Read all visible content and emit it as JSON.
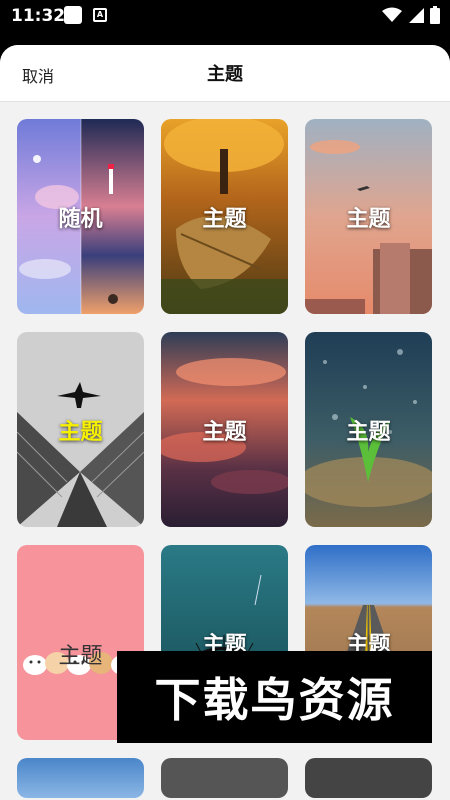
{
  "status_bar": {
    "time": "11:32",
    "notification_glyph": "A"
  },
  "header": {
    "cancel_label": "取消",
    "title": "主题"
  },
  "themes": [
    {
      "label": "随机",
      "label_color": "#ffffff"
    },
    {
      "label": "主题",
      "label_color": "#ffffff"
    },
    {
      "label": "主题",
      "label_color": "#ffffff"
    },
    {
      "label": "主题",
      "label_color": "#f7f000"
    },
    {
      "label": "主题",
      "label_color": "#ffffff"
    },
    {
      "label": "主题",
      "label_color": "#ffffff"
    },
    {
      "label": "主题",
      "label_color": "#333333"
    },
    {
      "label": "主题",
      "label_color": "#ffffff"
    },
    {
      "label": "主题",
      "label_color": "#ffffff"
    }
  ],
  "watermark": {
    "text": "下载鸟资源"
  },
  "icons": [
    "wifi-icon",
    "signal-icon",
    "battery-icon"
  ]
}
